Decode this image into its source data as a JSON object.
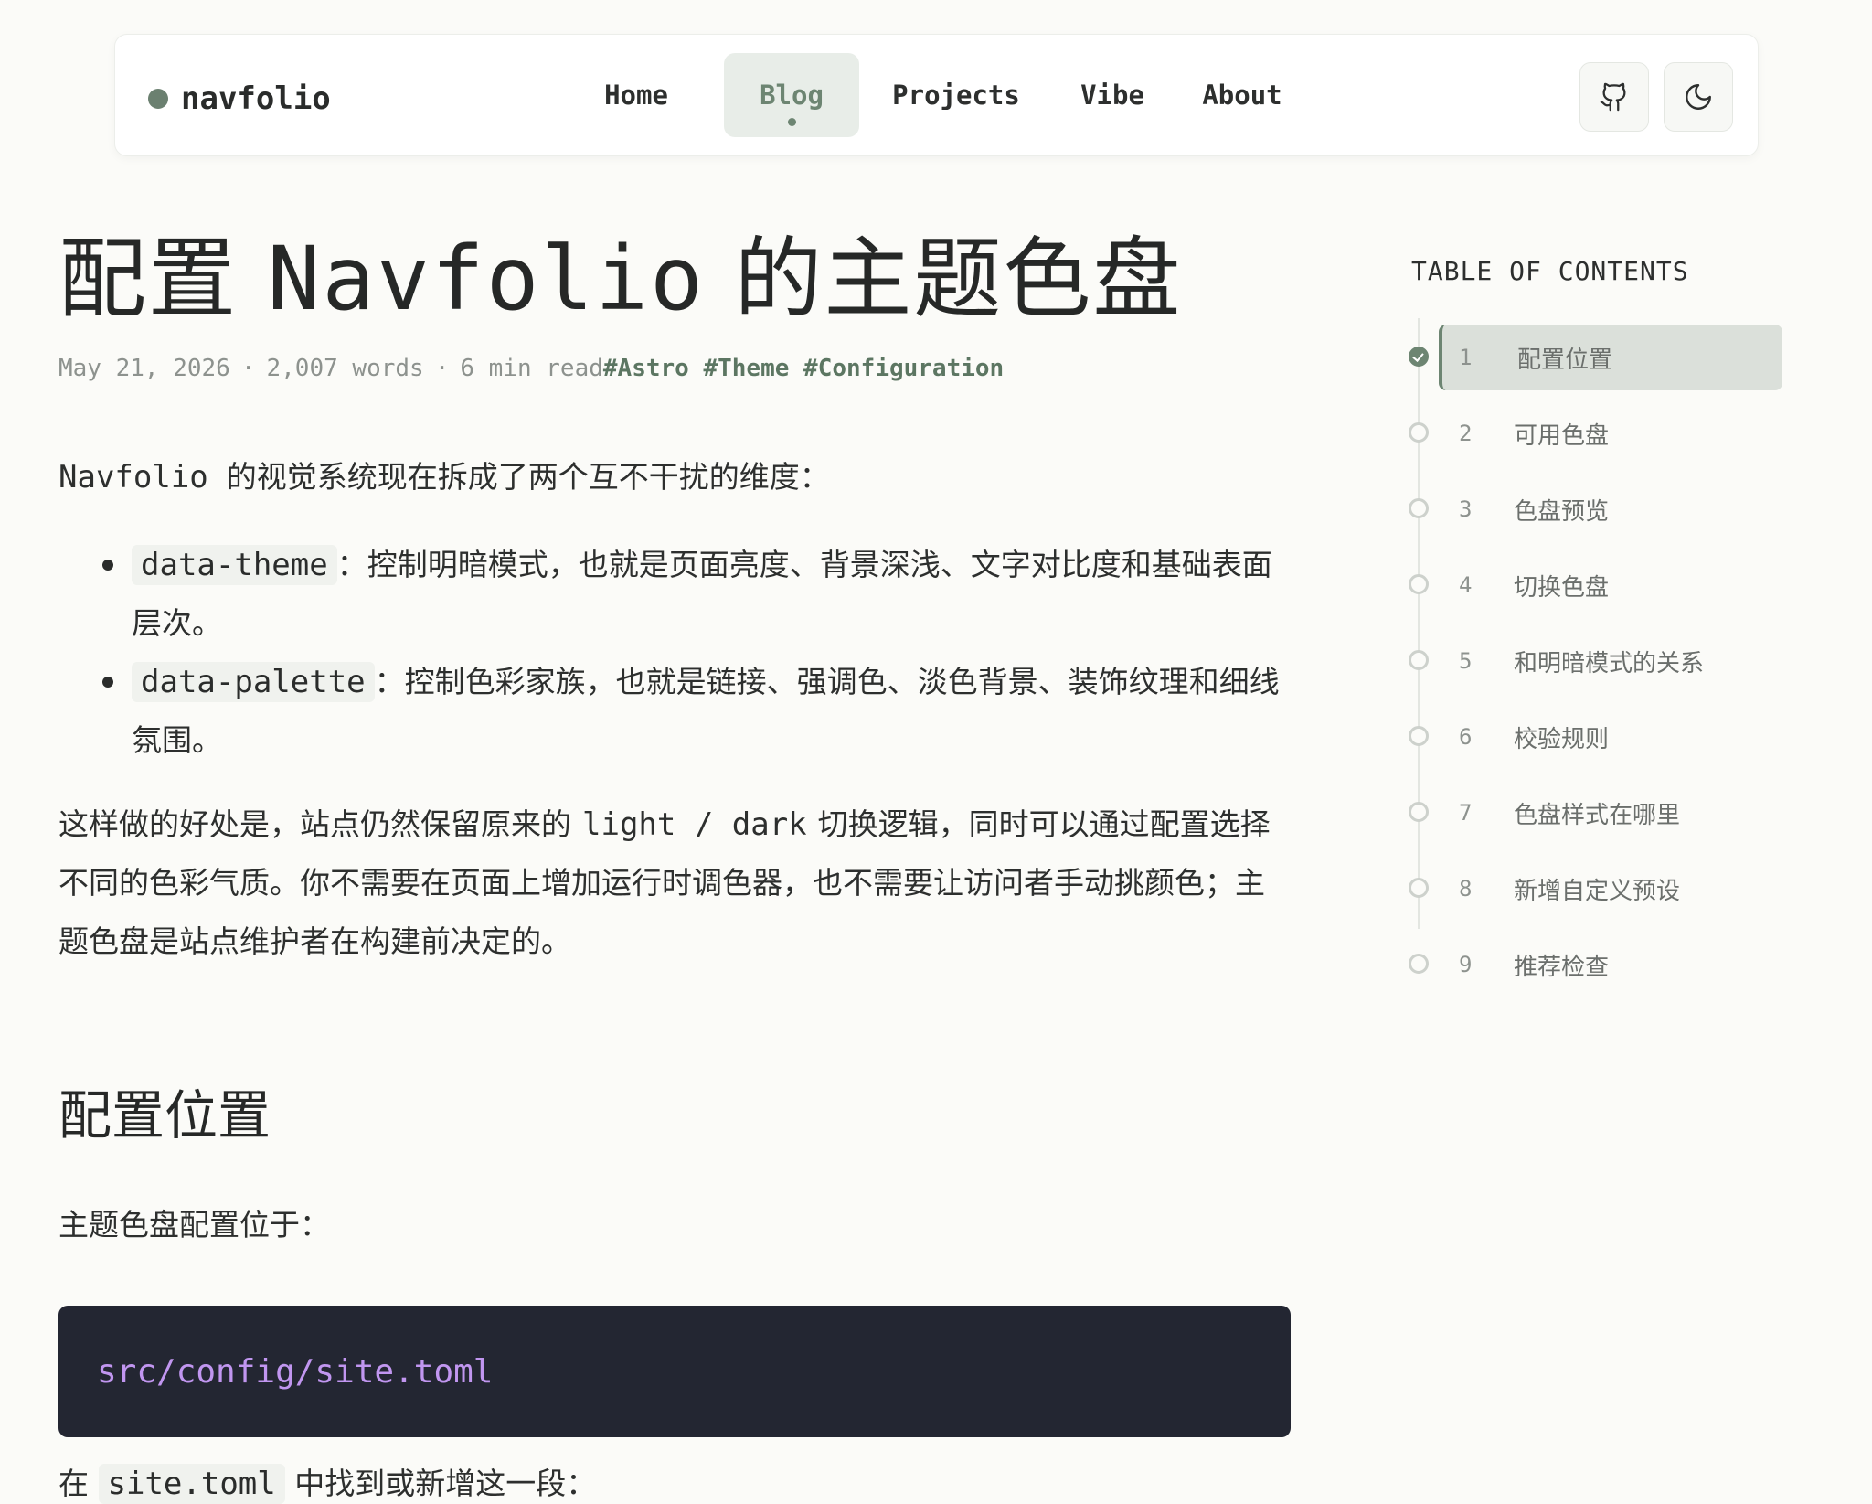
{
  "header": {
    "brand": "navfolio",
    "nav": [
      {
        "label": "Home",
        "active": false
      },
      {
        "label": "Blog",
        "active": true
      },
      {
        "label": "Projects",
        "active": false
      },
      {
        "label": "Vibe",
        "active": false
      },
      {
        "label": "About",
        "active": false
      }
    ],
    "actions": {
      "github_icon": "github-icon",
      "theme_icon": "moon-icon"
    }
  },
  "article": {
    "title_pre": "配置",
    "title_latin": "Navfolio",
    "title_post": "的主题色盘",
    "meta": {
      "date": "May 21, 2026",
      "words": "2,007 words",
      "read": "6 min read",
      "tags": [
        "#Astro",
        "#Theme",
        "#Configuration"
      ]
    },
    "intro_latin": "Navfolio",
    "intro_text": "的视觉系统现在拆成了两个互不干扰的维度：",
    "bullets": [
      {
        "code": "data-theme",
        "text": "：控制明暗模式，也就是页面亮度、背景深浅、文字对比度和基础表面层次。"
      },
      {
        "code": "data-palette",
        "text": "：控制色彩家族，也就是链接、强调色、淡色背景、装饰纹理和细线氛围。"
      }
    ],
    "para2_a": "这样做的好处是，站点仍然保留原来的",
    "para2_code": "light / dark",
    "para2_b": "切换逻辑，同时可以通过配置选择不同的色彩气质。你不需要在页面上增加运行时调色器，也不需要让访问者手动挑颜色；主题色盘是站点维护者在构建前决定的。",
    "h2": "配置位置",
    "para3": "主题色盘配置位于：",
    "code_block": "src/config/site.toml",
    "cut_pre": "在",
    "cut_code": "site.toml",
    "cut_post": "中找到或新增这一段："
  },
  "toc": {
    "title": "TABLE OF CONTENTS",
    "items": [
      {
        "num": "1",
        "label": "配置位置",
        "active": true
      },
      {
        "num": "2",
        "label": "可用色盘",
        "active": false
      },
      {
        "num": "3",
        "label": "色盘预览",
        "active": false
      },
      {
        "num": "4",
        "label": "切换色盘",
        "active": false
      },
      {
        "num": "5",
        "label": "和明暗模式的关系",
        "active": false
      },
      {
        "num": "6",
        "label": "校验规则",
        "active": false
      },
      {
        "num": "7",
        "label": "色盘样式在哪里",
        "active": false
      },
      {
        "num": "8",
        "label": "新增自定义预设",
        "active": false
      },
      {
        "num": "9",
        "label": "推荐检查",
        "active": false
      }
    ]
  },
  "colors": {
    "background": "#fbfbf8",
    "accent": "#6d8572",
    "code_bg": "#232632",
    "code_fg": "#c196f0"
  }
}
